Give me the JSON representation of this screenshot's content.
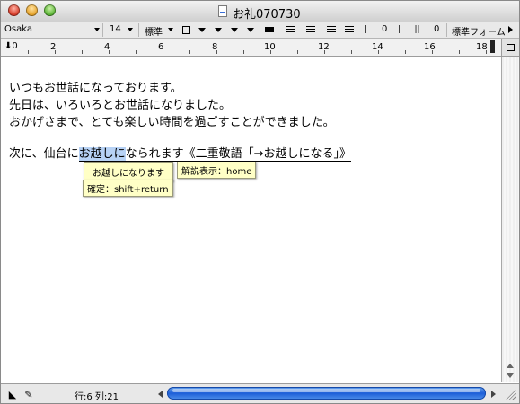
{
  "window": {
    "title": "お礼070730"
  },
  "toolbar": {
    "font_name": "Osaka",
    "font_size": "14",
    "style": "標準",
    "spacing_value_1": "0",
    "spacing_value_2": "0",
    "format": "標準フォーム"
  },
  "ruler": {
    "ticks": [
      "2",
      "4",
      "6",
      "8",
      "10",
      "12",
      "14",
      "16",
      "18"
    ]
  },
  "document": {
    "line1": "いつもお世話になっております。",
    "line2": "先日は、いろいろとお世話になりました。",
    "line3": "おかげさまで、とても楽しい時間を過ごすことができました。",
    "line5_prefix": "次に、仙台に",
    "line5_selected": "お越しに",
    "line5_suffix": "なられます《二重敬語「→お越しになる」》"
  },
  "tooltips": {
    "suggestion": "お越しになります",
    "explain": "解説表示：home",
    "confirm": "確定：shift+return"
  },
  "status": {
    "row_col": "行:6  列:21"
  },
  "colors": {
    "selection": "#b7d2f5",
    "tooltip_bg": "#ffffc6",
    "scroll_thumb": "#1e5fd8"
  }
}
